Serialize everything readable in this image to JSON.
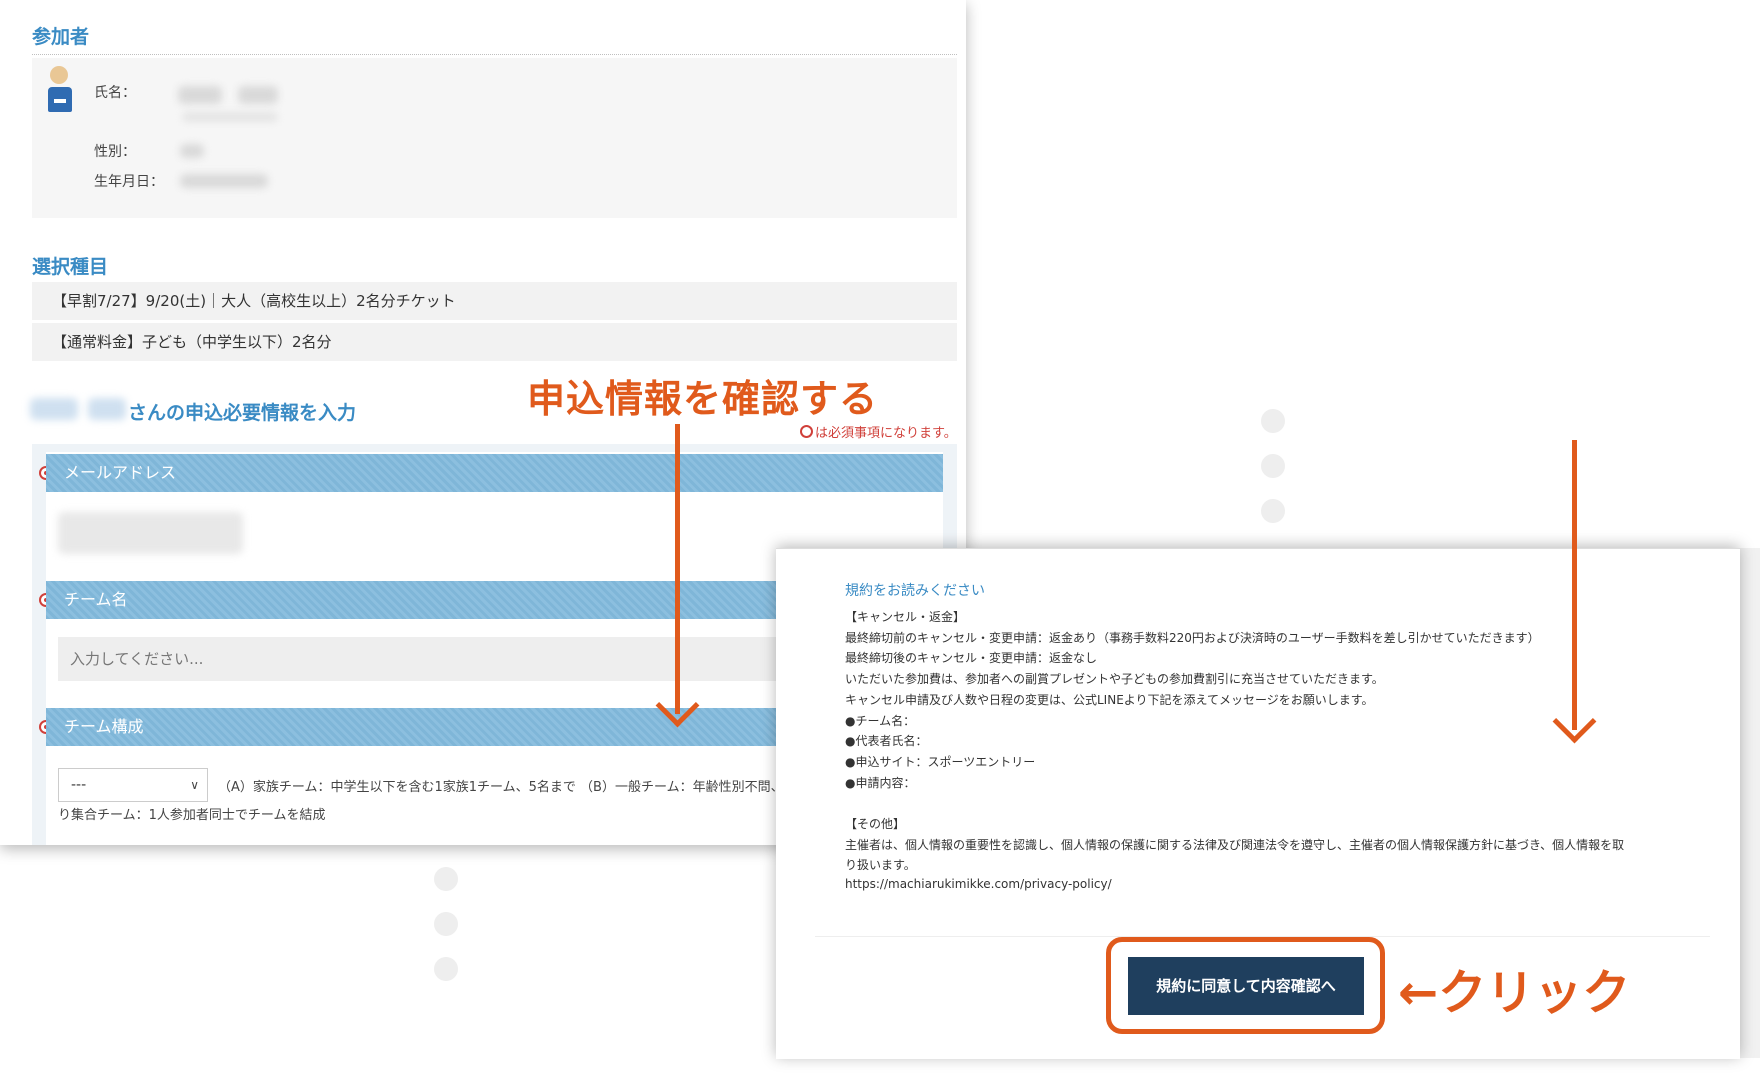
{
  "participant": {
    "section_title": "参加者",
    "name_label": "氏名：",
    "gender_label": "性別：",
    "birthdate_label": "生年月日："
  },
  "selection": {
    "section_title": "選択種目",
    "items": [
      "【早割7/27】9/20(土)｜大人（高校生以上）2名分チケット",
      "【通常料金】子ども（中学生以下）2名分"
    ]
  },
  "form": {
    "title_suffix": "さんの申込必要情報を入力",
    "required_note": "は必須事項になります。",
    "fields": {
      "email_label": "メールアドレス",
      "team_name_label": "チーム名",
      "team_name_placeholder": "入力してください...",
      "team_comp_label": "チーム構成",
      "team_comp_selected": "---",
      "team_comp_desc_1": "（A）家族チーム：中学生以下を含む1家族1チーム、5名まで （B）一般チーム：年齢性別不問、",
      "team_comp_desc_2": "り集合チーム：1人参加者同士でチームを結成"
    }
  },
  "annotations": {
    "confirm_title": "申込情報を確認する",
    "click_label": "←クリック",
    "accent_color": "#e05a1c"
  },
  "terms": {
    "heading": "規約をお読みください",
    "lines": [
      "【キャンセル・返金】",
      "最終締切前のキャンセル・変更申請：返金あり（事務手数料220円および決済時のユーザー手数料を差し引かせていただきます）",
      "最終締切後のキャンセル・変更申請：返金なし",
      "いただいた参加費は、参加者への副賞プレゼントや子どもの参加費割引に充当させていただきます。",
      "キャンセル申請及び人数や日程の変更は、公式LINEより下記を添えてメッセージをお願いします。",
      "●チーム名：",
      "●代表者氏名：",
      "●申込サイト：スポーツエントリー",
      "●申請内容：",
      "",
      "【その他】",
      "主催者は、個人情報の重要性を認識し、個人情報の保護に関する法律及び関連法令を遵守し、主催者の個人情報保護方針に基づき、個人情報を取",
      "り扱います。",
      "https://machiarukimikke.com/privacy-policy/"
    ],
    "agree_button": "規約に同意して内容確認へ"
  }
}
